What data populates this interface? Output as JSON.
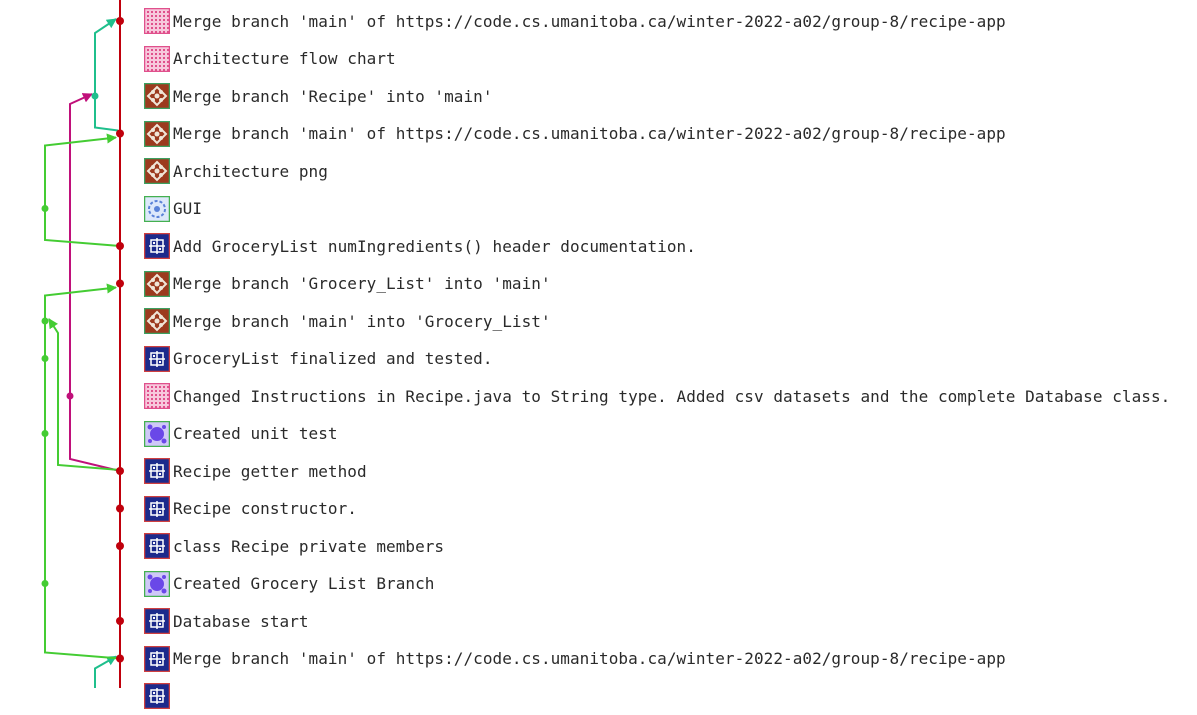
{
  "commits": [
    {
      "message": "Merge branch 'main' of https://code.cs.umanitoba.ca/winter-2022-a02/group-8/recipe-app",
      "avatar": "pink-identicon"
    },
    {
      "message": "Architecture flow chart",
      "avatar": "pink-identicon"
    },
    {
      "message": "Merge branch 'Recipe' into 'main'",
      "avatar": "brown-identicon"
    },
    {
      "message": "Merge branch 'main' of https://code.cs.umanitoba.ca/winter-2022-a02/group-8/recipe-app",
      "avatar": "brown-identicon"
    },
    {
      "message": "Architecture png",
      "avatar": "brown-identicon"
    },
    {
      "message": "GUI",
      "avatar": "lightblue-identicon"
    },
    {
      "message": "Add GroceryList numIngredients() header documentation.",
      "avatar": "navy-identicon"
    },
    {
      "message": "Merge branch 'Grocery_List' into 'main'",
      "avatar": "brown-identicon"
    },
    {
      "message": "Merge branch 'main' into 'Grocery_List'",
      "avatar": "brown-identicon"
    },
    {
      "message": "GroceryList finalized and tested.",
      "avatar": "navy-identicon"
    },
    {
      "message": "Changed Instructions in Recipe.java to String type. Added csv datasets and the complete Database class.",
      "avatar": "pink-identicon"
    },
    {
      "message": "Created unit test",
      "avatar": "purple-identicon"
    },
    {
      "message": "Recipe getter method",
      "avatar": "navy-identicon"
    },
    {
      "message": "Recipe constructor.",
      "avatar": "navy-identicon"
    },
    {
      "message": "class Recipe private members",
      "avatar": "navy-identicon"
    },
    {
      "message": "Created Grocery List Branch",
      "avatar": "purple-identicon"
    },
    {
      "message": "Database start",
      "avatar": "navy-identicon"
    },
    {
      "message": "Merge branch 'main' of https://code.cs.umanitoba.ca/winter-2022-a02/group-8/recipe-app",
      "avatar": "navy-identicon"
    },
    {
      "message": "",
      "avatar": "navy-identicon"
    }
  ],
  "colors": {
    "main_lane": "#c0000c",
    "teal_lane": "#1fbf8c",
    "green_lane": "#44cc33",
    "magenta_lane": "#c0107a",
    "text": "#2a2a2a"
  }
}
